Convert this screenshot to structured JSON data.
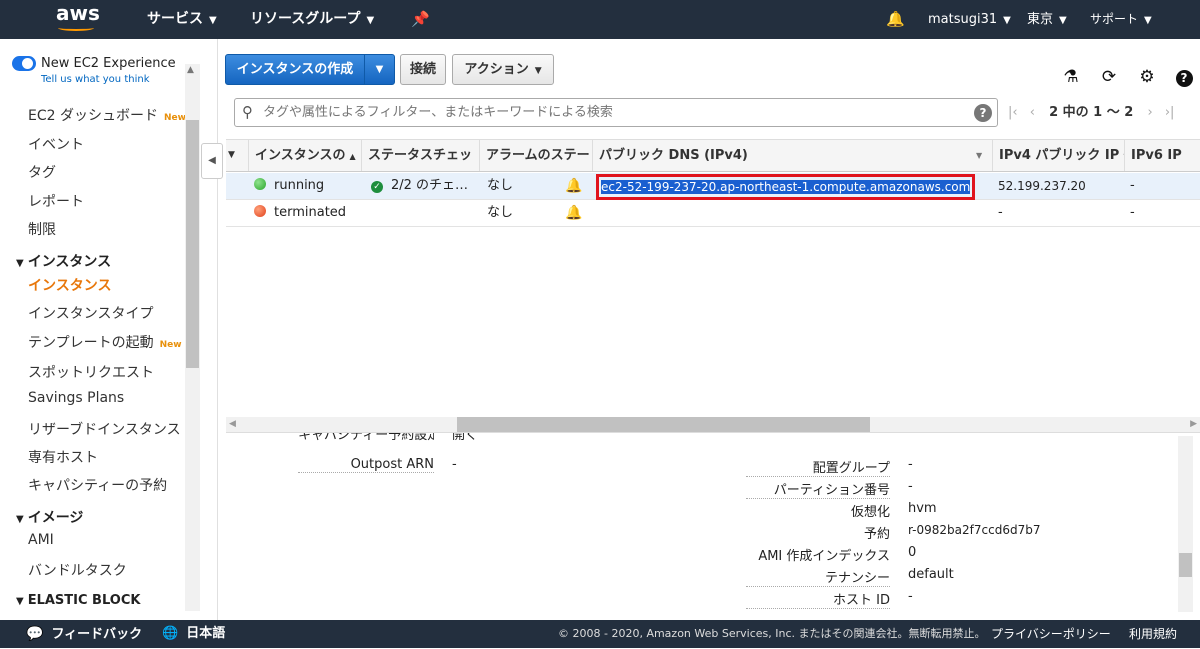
{
  "topbar": {
    "logo": "aws",
    "services": "サービス",
    "resource_groups": "リソースグループ",
    "pin_icon": "pin-icon",
    "bell_icon": "bell-icon",
    "user": "matsugi31",
    "region": "東京",
    "support": "サポート"
  },
  "sidebar": {
    "toggle_label": "New EC2 Experience",
    "toggle_sub": "Tell us what you think",
    "items": [
      {
        "label": "EC2 ダッシュボード",
        "badge": "New"
      },
      {
        "label": "イベント"
      },
      {
        "label": "タグ"
      },
      {
        "label": "レポート"
      },
      {
        "label": "制限"
      }
    ],
    "section_instances": "インスタンス",
    "instances_items": [
      {
        "label": "インスタンス",
        "active": true
      },
      {
        "label": "インスタンスタイプ"
      },
      {
        "label": "テンプレートの起動",
        "badge": "New"
      },
      {
        "label": "スポットリクエスト"
      },
      {
        "label": "Savings Plans"
      },
      {
        "label": "リザーブドインスタンス"
      },
      {
        "label": "専有ホスト"
      },
      {
        "label": "キャパシティーの予約"
      }
    ],
    "section_images": "イメージ",
    "images_items": [
      {
        "label": "AMI"
      },
      {
        "label": "バンドルタスク"
      }
    ],
    "section_ebs": "ELASTIC BLOCK"
  },
  "toolbar": {
    "create_instance": "インスタンスの作成",
    "connect": "接続",
    "actions": "アクション",
    "icons": [
      "flask-icon",
      "refresh-icon",
      "gear-icon",
      "help-icon"
    ]
  },
  "search": {
    "placeholder": "タグや属性によるフィルター、またはキーワードによる検索"
  },
  "pager": {
    "text": "2 中の 1 ～ 2"
  },
  "table": {
    "headers": [
      "インスタンスの",
      "ステータスチェッ",
      "アラームのステー",
      "パブリック DNS (IPv4)",
      "IPv4 パブリック IP",
      "IPv6 IP"
    ],
    "rows": [
      {
        "state": "running",
        "state_color": "#3ab53a",
        "status": "2/2 のチェ…",
        "alarm": "なし",
        "dns": "ec2-52-199-237-20.ap-northeast-1.compute.amazonaws.com",
        "ipv4": "52.199.237.20",
        "ipv6": "-",
        "selected": true
      },
      {
        "state": "terminated",
        "state_color": "#e8491d",
        "status": "",
        "alarm": "なし",
        "dns": "",
        "ipv4": "-",
        "ipv6": "-",
        "selected": false
      }
    ]
  },
  "details": {
    "partial_label": "キャパシティー予約設定",
    "partial_value": "開く",
    "left": [
      {
        "label": "Outpost ARN",
        "value": "-"
      }
    ],
    "right": [
      {
        "label": "配置グループ",
        "value": "-"
      },
      {
        "label": "パーティション番号",
        "value": "-"
      },
      {
        "label": "仮想化",
        "value": "hvm"
      },
      {
        "label": "予約",
        "value": "r-0982ba2f7ccd6d7b7"
      },
      {
        "label": "AMI 作成インデックス",
        "value": "0"
      },
      {
        "label": "テナンシー",
        "value": "default"
      },
      {
        "label": "ホスト ID",
        "value": "-"
      }
    ]
  },
  "footer": {
    "feedback": "フィードバック",
    "language": "日本語",
    "copyright": "© 2008 - 2020, Amazon Web Services, Inc. またはその関連会社。無断転用禁止。",
    "privacy": "プライバシーポリシー",
    "terms": "利用規約"
  }
}
